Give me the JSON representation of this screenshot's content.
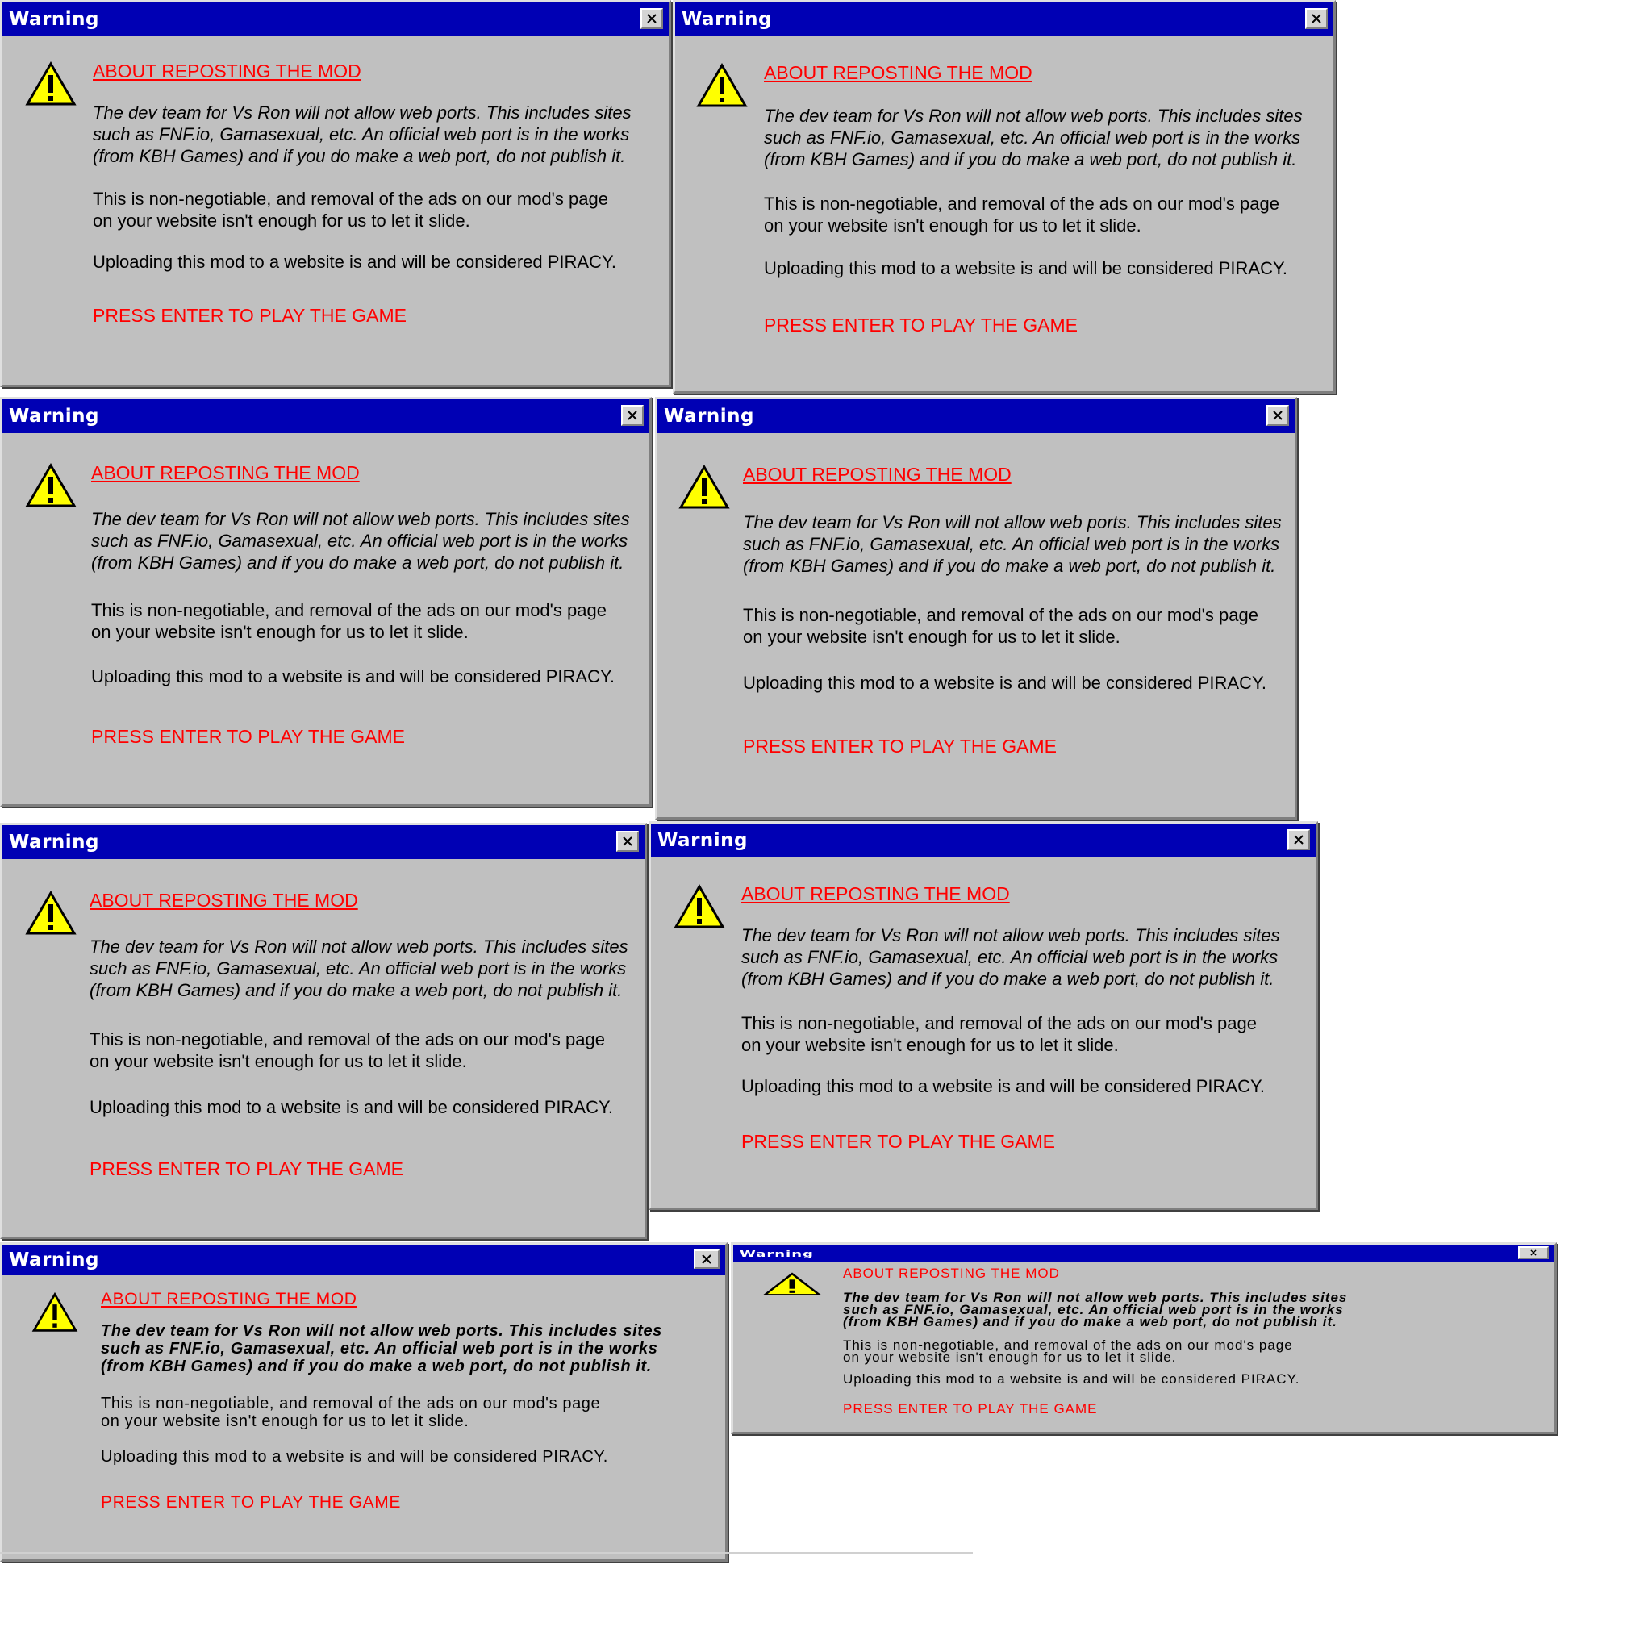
{
  "dialog": {
    "title": "Warning",
    "heading": "ABOUT REPOSTING THE MOD",
    "paragraph_italic": "The dev team for Vs Ron will not allow web ports. This includes sites\nsuch as FNF.io, Gamasexual, etc. An official web port is in the works\n(from KBH Games) and if you do make a web port, do not publish it.",
    "paragraph_negotiable": "This is non-negotiable, and removal of the ads on our mod's page\non your website isn't enough for us to let it slide.",
    "paragraph_piracy": "Uploading this mod to a website is and will be considered PIRACY.",
    "press_enter": "PRESS ENTER TO PLAY THE GAME"
  },
  "colors": {
    "titlebar": "#0000b4",
    "window_bg": "#c0c0c0",
    "accent_red": "#ff0000"
  },
  "icons": {
    "warning": "warning-triangle-icon",
    "close": "close-x-icon"
  }
}
